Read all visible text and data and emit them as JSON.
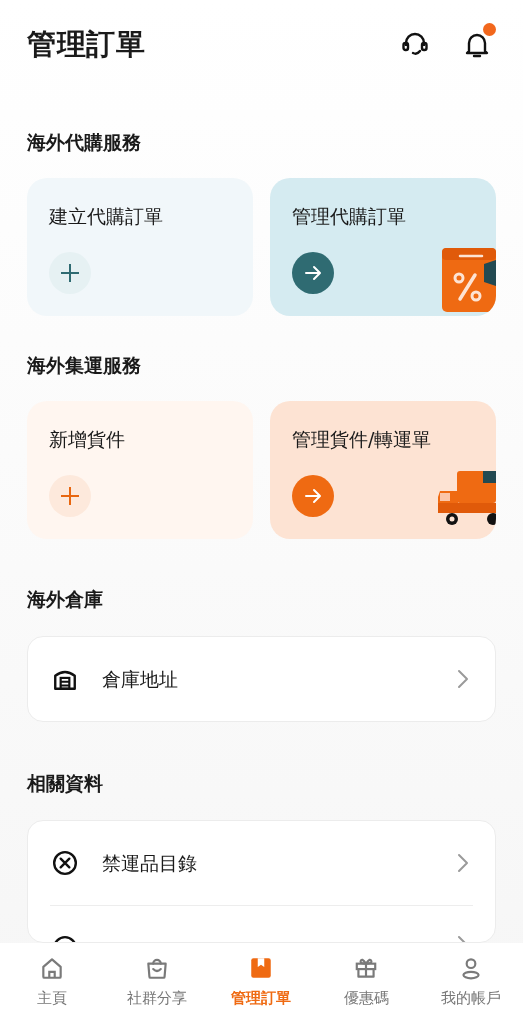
{
  "header": {
    "title": "管理訂單",
    "has_unread": true
  },
  "service_sections": [
    {
      "title": "海外代購服務",
      "kind": "purchase",
      "cards": [
        {
          "kind": "create",
          "label": "建立代購訂單"
        },
        {
          "kind": "manage",
          "label": "管理代購訂單"
        }
      ]
    },
    {
      "title": "海外集運服務",
      "kind": "shipping",
      "cards": [
        {
          "kind": "create",
          "label": "新增貨件"
        },
        {
          "kind": "manage",
          "label": "管理貨件/轉運單"
        }
      ]
    }
  ],
  "warehouse": {
    "title": "海外倉庫",
    "items": [
      {
        "kind": "warehouse",
        "label": "倉庫地址"
      }
    ]
  },
  "resources": {
    "title": "相關資料",
    "items": [
      {
        "kind": "prohibited",
        "label": "禁運品目錄"
      },
      {
        "kind": "pickup"
      }
    ]
  },
  "bottom_nav": [
    {
      "kind": "home",
      "label": "主頁",
      "selected": false
    },
    {
      "kind": "community",
      "label": "社群分享",
      "selected": false
    },
    {
      "kind": "orders",
      "label": "管理訂單",
      "selected": true
    },
    {
      "kind": "coupon",
      "label": "優惠碼",
      "selected": false
    },
    {
      "kind": "account",
      "label": "我的帳戶",
      "selected": false
    }
  ]
}
